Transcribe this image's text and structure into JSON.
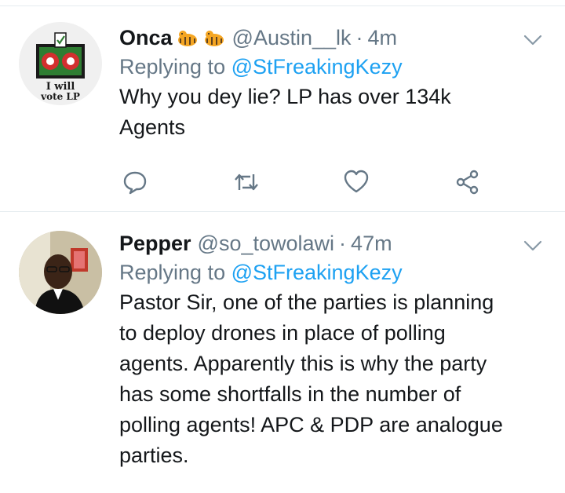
{
  "tweets": [
    {
      "name": "Onca",
      "handle": "@Austin__lk",
      "separator": "·",
      "time": "4m",
      "replying_prefix": "Replying to",
      "replying_to": "@StFreakingKezy",
      "body_lines": [
        "Why you dey lie? LP has over 134k",
        "Agents"
      ],
      "avatar_text": [
        "I will",
        "vote LP"
      ],
      "name_emojis": [
        "tiger-emoji",
        "tiger-emoji"
      ],
      "actions": [
        "reply-icon",
        "retweet-icon",
        "like-icon",
        "share-icon"
      ]
    },
    {
      "name": "Pepper",
      "handle": "@so_towolawi",
      "separator": "·",
      "time": "47m",
      "replying_prefix": "Replying to",
      "replying_to": "@StFreakingKezy",
      "body_lines": [
        "Pastor Sir, one of the parties is planning",
        "to deploy drones in place of polling",
        "agents. Apparently this is why the party",
        "has some shortfalls in the number of",
        "polling agents! APC & PDP are analogue",
        "parties."
      ]
    }
  ],
  "colors": {
    "text": "#14171a",
    "secondary": "#657786",
    "link": "#1da1f2",
    "icon": "#657786",
    "divider": "#e6ecf0"
  }
}
